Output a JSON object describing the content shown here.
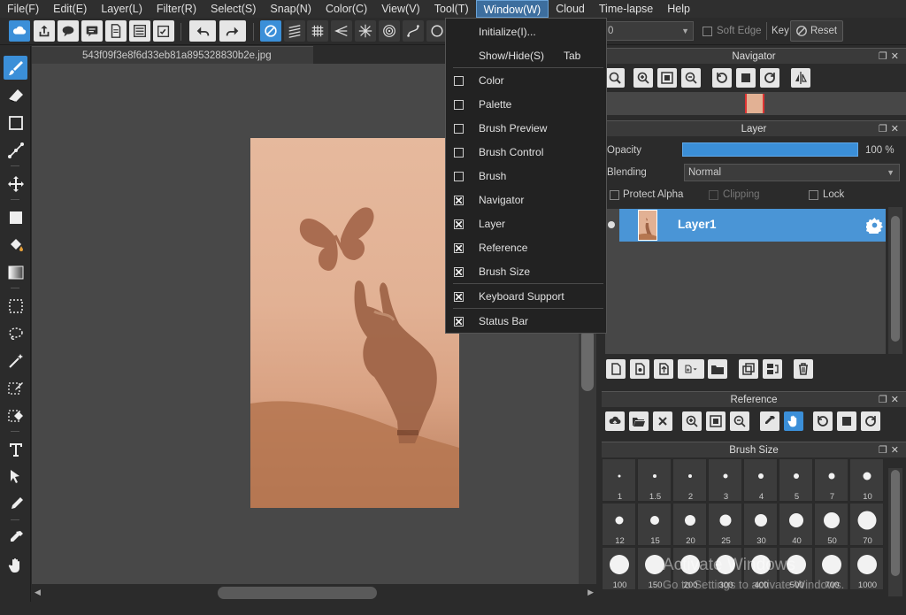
{
  "menu": {
    "items": [
      "File(F)",
      "Edit(E)",
      "Layer(L)",
      "Filter(R)",
      "Select(S)",
      "Snap(N)",
      "Color(C)",
      "View(V)",
      "Tool(T)",
      "Window(W)",
      "Cloud",
      "Time-lapse",
      "Help"
    ],
    "active": "Window(W)"
  },
  "window_menu": {
    "items": [
      {
        "label": "Initialize(I)..."
      },
      {
        "label": "Show/Hide(S)",
        "shortcut": "Tab"
      },
      {
        "label": "Color",
        "checked": false
      },
      {
        "label": "Palette",
        "checked": false
      },
      {
        "label": "Brush Preview",
        "checked": false
      },
      {
        "label": "Brush Control",
        "checked": false
      },
      {
        "label": "Brush",
        "checked": false
      },
      {
        "label": "Navigator",
        "checked": true
      },
      {
        "label": "Layer",
        "checked": true
      },
      {
        "label": "Reference",
        "checked": true
      },
      {
        "label": "Brush Size",
        "checked": true
      },
      {
        "label": "Keyboard Support",
        "checked": true
      },
      {
        "label": "Status Bar",
        "checked": true
      }
    ]
  },
  "document": {
    "tab_title": "543f09f3e8f6d33eb81a895328830b2e.jpg"
  },
  "tool_options": {
    "field_value": "0",
    "soft_edge_label": "Soft Edge",
    "key_label": "Key",
    "reset_label": "Reset"
  },
  "panels": {
    "navigator": {
      "title": "Navigator"
    },
    "layer": {
      "title": "Layer",
      "opacity_label": "Opacity",
      "opacity_value": "100 %",
      "opacity_fraction": 1.0,
      "blending_label": "Blending",
      "blending_value": "Normal",
      "protect_alpha_label": "Protect Alpha",
      "clipping_label": "Clipping",
      "lock_label": "Lock",
      "layers": [
        {
          "name": "Layer1"
        }
      ]
    },
    "reference": {
      "title": "Reference"
    },
    "brush_size": {
      "title": "Brush Size",
      "sizes": [
        "1",
        "1.5",
        "2",
        "3",
        "4",
        "5",
        "7",
        "10",
        "12",
        "15",
        "20",
        "25",
        "30",
        "40",
        "50",
        "70",
        "100",
        "150",
        "200",
        "300",
        "400",
        "500",
        "700",
        "1000"
      ]
    }
  },
  "watermark": {
    "line1": "Activate Windows",
    "line2": "Go to Settings to activate Windows."
  },
  "colors": {
    "accent": "#3b8fd8",
    "menu_active": "#3d6e9e",
    "layer_selected": "#4a95d6"
  }
}
